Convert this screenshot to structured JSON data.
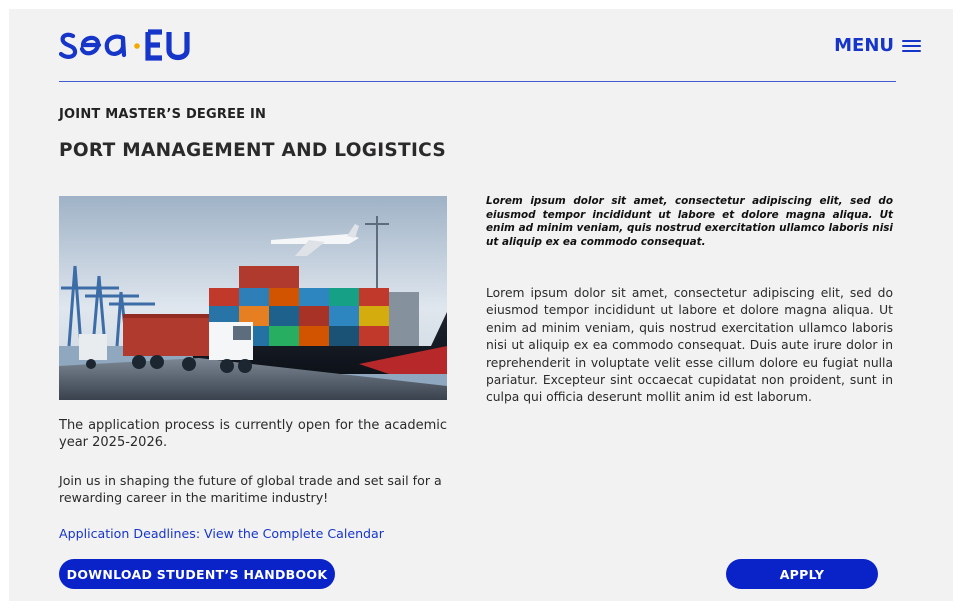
{
  "brand": {
    "logo_text": "sea·EU",
    "accent_color": "#1635c9",
    "dot_color": "#f2a900"
  },
  "header": {
    "menu_label": "MENU",
    "menu_icon": "hamburger-icon"
  },
  "program": {
    "subtitle": "JOINT MASTER’S DEGREE IN",
    "title": "PORT MANAGEMENT AND LOGISTICS"
  },
  "hero_image": {
    "description_icon": "cargo-ship-truck-plane-image"
  },
  "left_column": {
    "intro": "The application process is currently open for the academic year 2025-2026.",
    "call_to_action": "Join us in shaping the future of global trade and set sail for a rewarding career in the maritime industry!",
    "deadline_link": "Application Deadlines: View the Complete Calendar"
  },
  "right_column": {
    "lead": "Lorem ipsum dolor sit amet, consectetur adipiscing elit, sed do eiusmod tempor incididunt ut labore et dolore magna aliqua. Ut enim ad minim veniam, quis nostrud exercitation ullamco laboris nisi ut aliquip ex ea commodo consequat.",
    "body": "Lorem ipsum dolor sit amet, consectetur adipiscing elit, sed do eiusmod tempor incididunt ut labore et dolore magna aliqua. Ut enim ad minim veniam, quis nostrud exercitation ullamco laboris nisi ut aliquip ex ea commodo consequat. Duis aute irure dolor in reprehenderit in voluptate velit esse cillum dolore eu fugiat nulla pariatur. Excepteur sint occaecat cupidatat non proident, sunt in culpa qui officia deserunt mollit anim id est laborum."
  },
  "buttons": {
    "handbook_label": "DOWNLOAD STUDENT’S HANDBOOK",
    "apply_label": "APPLY",
    "button_color": "#0a23c9"
  }
}
